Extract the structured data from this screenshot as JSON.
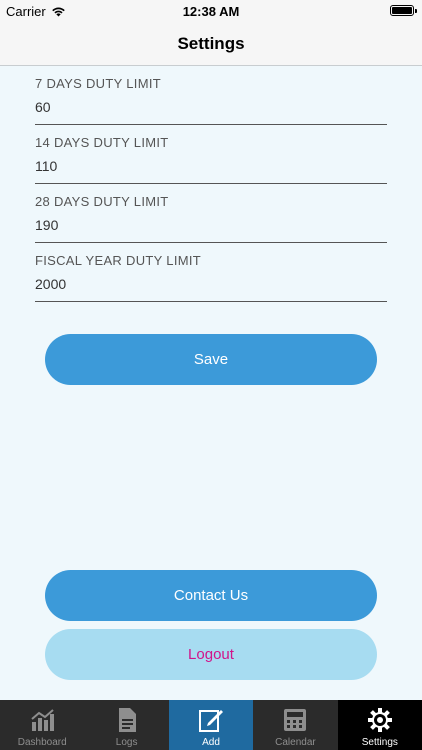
{
  "status": {
    "carrier": "Carrier",
    "time": "12:38 AM"
  },
  "nav": {
    "title": "Settings"
  },
  "fields": [
    {
      "label": "7 DAYS DUTY LIMIT",
      "value": "60"
    },
    {
      "label": "14 DAYS DUTY LIMIT",
      "value": "110"
    },
    {
      "label": "28 DAYS DUTY LIMIT",
      "value": "190"
    },
    {
      "label": "FISCAL YEAR DUTY LIMIT",
      "value": "2000"
    }
  ],
  "buttons": {
    "save": "Save",
    "contact": "Contact Us",
    "logout": "Logout"
  },
  "colors": {
    "primary": "#3c9ad9",
    "logout_bg": "#a7dcf1",
    "logout_text": "#d1148a",
    "tab_bg": "#2b2b2b",
    "tab_highlight": "#1f6aa0"
  },
  "tabs": [
    {
      "label": "Dashboard",
      "icon": "bar-chart-icon"
    },
    {
      "label": "Logs",
      "icon": "document-icon"
    },
    {
      "label": "Add",
      "icon": "edit-icon"
    },
    {
      "label": "Calendar",
      "icon": "calculator-icon"
    },
    {
      "label": "Settings",
      "icon": "gear-icon"
    }
  ]
}
